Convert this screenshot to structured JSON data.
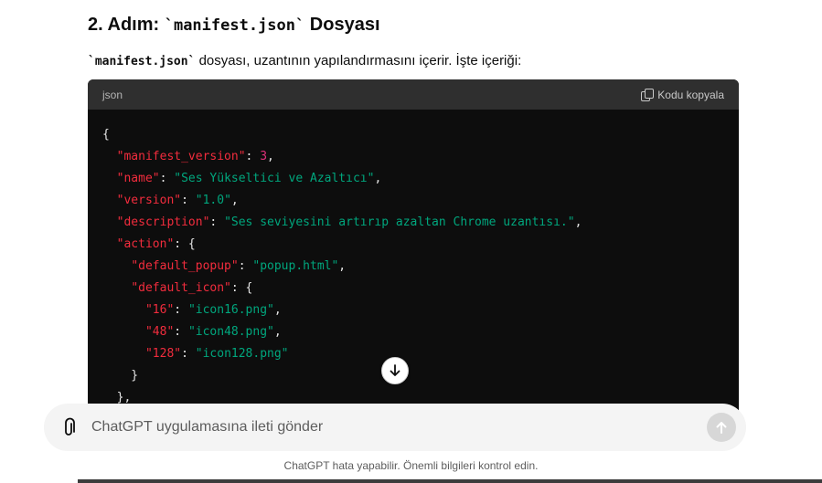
{
  "heading": {
    "prefix": "2. Adım: ",
    "code": "`manifest.json`",
    "suffix": " Dosyası"
  },
  "paragraph": {
    "code": "`manifest.json`",
    "text": " dosyası, uzantının yapılandırmasını içerir. İşte içeriği:"
  },
  "code_block": {
    "language": "json",
    "copy_label": "Kodu kopyala",
    "lines": [
      [
        {
          "t": "p",
          "v": "{"
        }
      ],
      [
        {
          "t": "p",
          "v": "  "
        },
        {
          "t": "k",
          "v": "\"manifest_version\""
        },
        {
          "t": "p",
          "v": ": "
        },
        {
          "t": "n",
          "v": "3"
        },
        {
          "t": "p",
          "v": ","
        }
      ],
      [
        {
          "t": "p",
          "v": "  "
        },
        {
          "t": "k",
          "v": "\"name\""
        },
        {
          "t": "p",
          "v": ": "
        },
        {
          "t": "s",
          "v": "\"Ses Yükseltici ve Azaltıcı\""
        },
        {
          "t": "p",
          "v": ","
        }
      ],
      [
        {
          "t": "p",
          "v": "  "
        },
        {
          "t": "k",
          "v": "\"version\""
        },
        {
          "t": "p",
          "v": ": "
        },
        {
          "t": "s",
          "v": "\"1.0\""
        },
        {
          "t": "p",
          "v": ","
        }
      ],
      [
        {
          "t": "p",
          "v": "  "
        },
        {
          "t": "k",
          "v": "\"description\""
        },
        {
          "t": "p",
          "v": ": "
        },
        {
          "t": "s",
          "v": "\"Ses seviyesini artırıp azaltan Chrome uzantısı.\""
        },
        {
          "t": "p",
          "v": ","
        }
      ],
      [
        {
          "t": "p",
          "v": "  "
        },
        {
          "t": "k",
          "v": "\"action\""
        },
        {
          "t": "p",
          "v": ": {"
        }
      ],
      [
        {
          "t": "p",
          "v": "    "
        },
        {
          "t": "k",
          "v": "\"default_popup\""
        },
        {
          "t": "p",
          "v": ": "
        },
        {
          "t": "s",
          "v": "\"popup.html\""
        },
        {
          "t": "p",
          "v": ","
        }
      ],
      [
        {
          "t": "p",
          "v": "    "
        },
        {
          "t": "k",
          "v": "\"default_icon\""
        },
        {
          "t": "p",
          "v": ": {"
        }
      ],
      [
        {
          "t": "p",
          "v": "      "
        },
        {
          "t": "k",
          "v": "\"16\""
        },
        {
          "t": "p",
          "v": ": "
        },
        {
          "t": "s",
          "v": "\"icon16.png\""
        },
        {
          "t": "p",
          "v": ","
        }
      ],
      [
        {
          "t": "p",
          "v": "      "
        },
        {
          "t": "k",
          "v": "\"48\""
        },
        {
          "t": "p",
          "v": ": "
        },
        {
          "t": "s",
          "v": "\"icon48.png\""
        },
        {
          "t": "p",
          "v": ","
        }
      ],
      [
        {
          "t": "p",
          "v": "      "
        },
        {
          "t": "k",
          "v": "\"128\""
        },
        {
          "t": "p",
          "v": ": "
        },
        {
          "t": "s",
          "v": "\"icon128.png\""
        }
      ],
      [
        {
          "t": "p",
          "v": "    }"
        }
      ],
      [
        {
          "t": "p",
          "v": "  },"
        }
      ]
    ]
  },
  "composer": {
    "placeholder": "ChatGPT uygulamasına ileti gönder"
  },
  "disclaimer": "ChatGPT hata yapabilir. Önemli bilgileri kontrol edin.",
  "colors": {
    "code_bg": "#0d0d0d",
    "code_header_bg": "#2f2f2f",
    "key": "#f22c3d",
    "string": "#00a67d",
    "number": "#df3079"
  },
  "icons": [
    "copy-icon",
    "arrow-down-icon",
    "paperclip-icon",
    "arrow-up-icon"
  ]
}
